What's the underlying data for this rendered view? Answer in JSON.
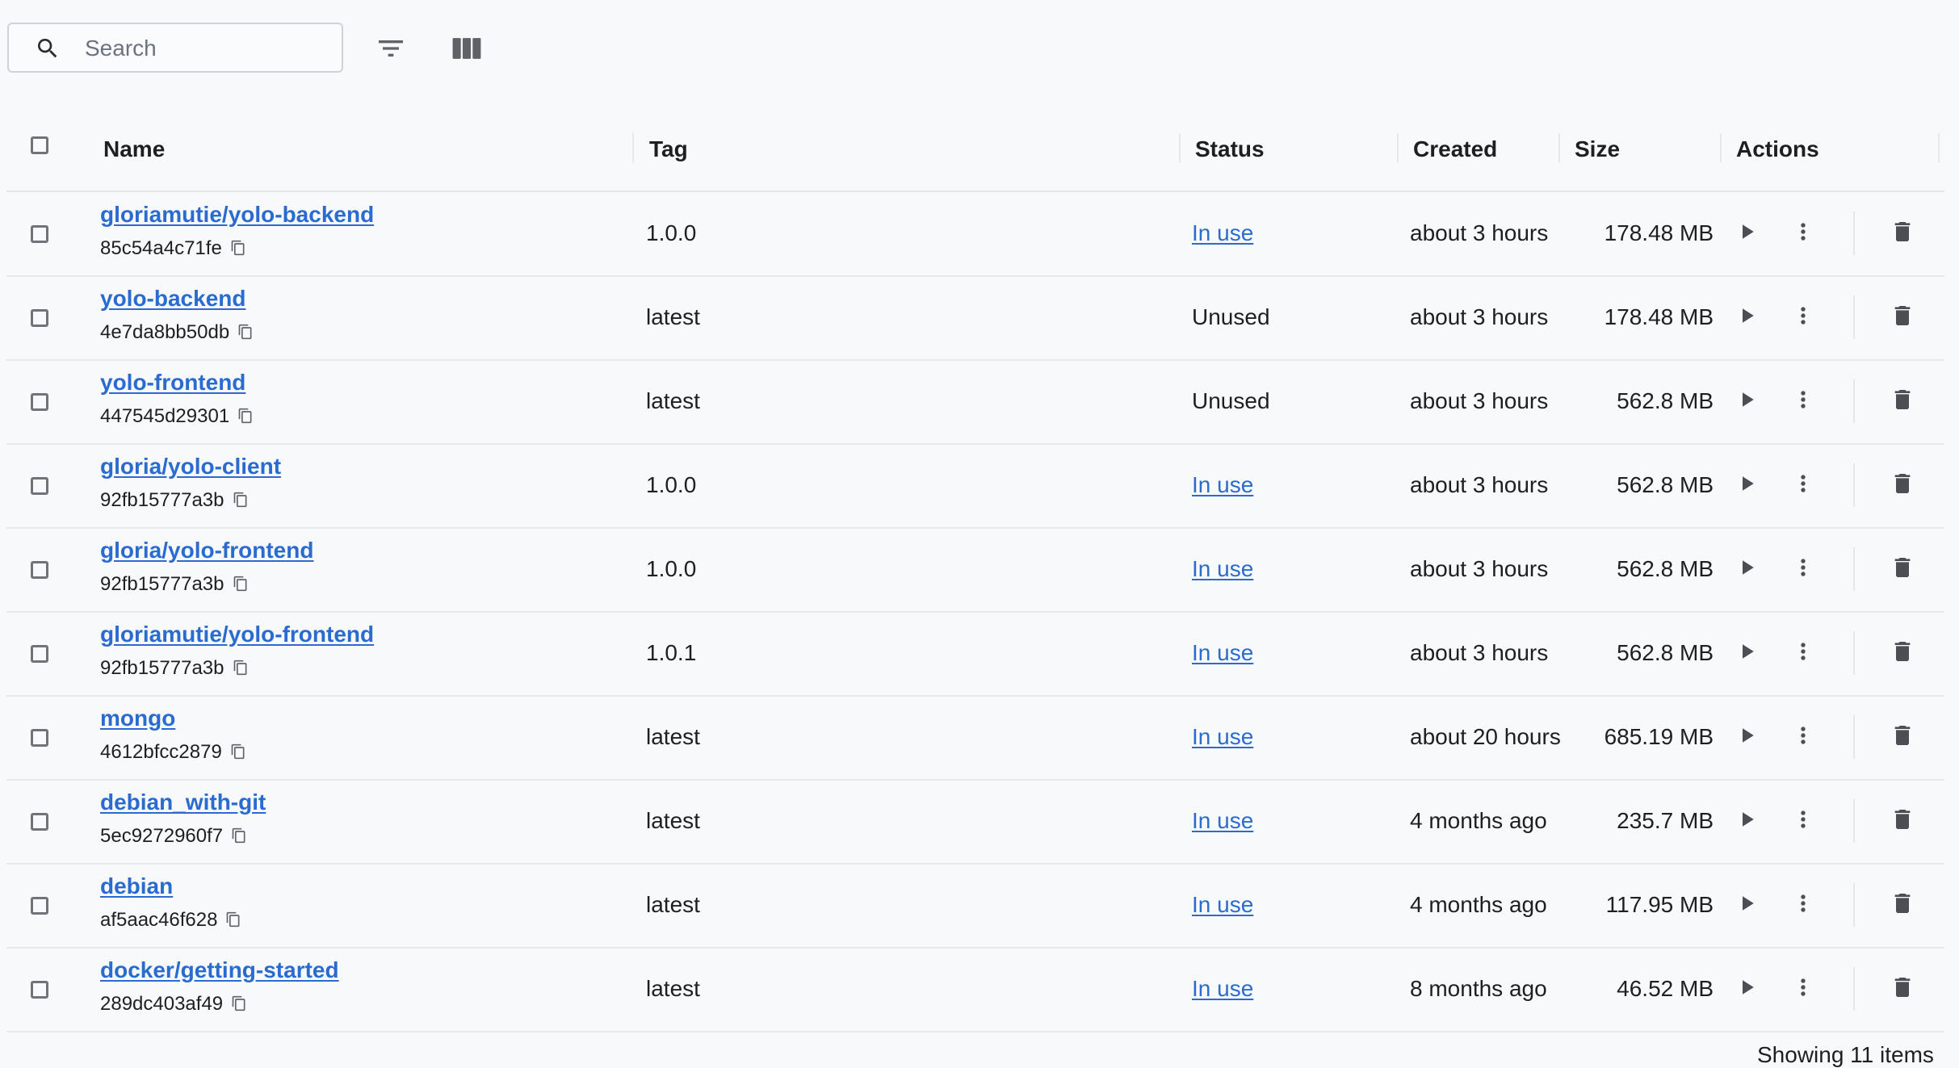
{
  "toolbar": {
    "search_placeholder": "Search",
    "search_value": "",
    "icons": {
      "search": "search-icon",
      "filter": "filter-icon",
      "columns": "columns-icon"
    }
  },
  "table": {
    "columns": [
      "Name",
      "Tag",
      "Status",
      "Created",
      "Size",
      "Actions"
    ],
    "rows": [
      {
        "name": "gloriamutie/yolo-backend",
        "id": "85c54a4c71fe",
        "tag": "1.0.0",
        "status": "In use",
        "created": "about 3 hours",
        "size": "178.48 MB"
      },
      {
        "name": "yolo-backend",
        "id": "4e7da8bb50db",
        "tag": "latest",
        "status": "Unused",
        "created": "about 3 hours",
        "size": "178.48 MB"
      },
      {
        "name": "yolo-frontend",
        "id": "447545d29301",
        "tag": "latest",
        "status": "Unused",
        "created": "about 3 hours",
        "size": "562.8 MB"
      },
      {
        "name": "gloria/yolo-client",
        "id": "92fb15777a3b",
        "tag": "1.0.0",
        "status": "In use",
        "created": "about 3 hours",
        "size": "562.8 MB"
      },
      {
        "name": "gloria/yolo-frontend",
        "id": "92fb15777a3b",
        "tag": "1.0.0",
        "status": "In use",
        "created": "about 3 hours",
        "size": "562.8 MB"
      },
      {
        "name": "gloriamutie/yolo-frontend",
        "id": "92fb15777a3b",
        "tag": "1.0.1",
        "status": "In use",
        "created": "about 3 hours",
        "size": "562.8 MB"
      },
      {
        "name": "mongo",
        "id": "4612bfcc2879",
        "tag": "latest",
        "status": "In use",
        "created": "about 20 hours",
        "size": "685.19 MB"
      },
      {
        "name": "debian_with-git",
        "id": "5ec9272960f7",
        "tag": "latest",
        "status": "In use",
        "created": "4 months ago",
        "size": "235.7 MB"
      },
      {
        "name": "debian",
        "id": "af5aac46f628",
        "tag": "latest",
        "status": "In use",
        "created": "4 months ago",
        "size": "117.95 MB"
      },
      {
        "name": "docker/getting-started",
        "id": "289dc403af49",
        "tag": "latest",
        "status": "In use",
        "created": "8 months ago",
        "size": "46.52 MB"
      }
    ],
    "row_icons": {
      "copy": "copy-icon",
      "run": "play-icon",
      "more": "more-vert-icon",
      "delete": "trash-icon"
    }
  },
  "footer": {
    "count_text": "Showing 11 items"
  },
  "colors": {
    "link": "#2a6bd0",
    "background": "#f8f9fa",
    "text": "#1f1f1f",
    "border": "#e4e6e9"
  }
}
